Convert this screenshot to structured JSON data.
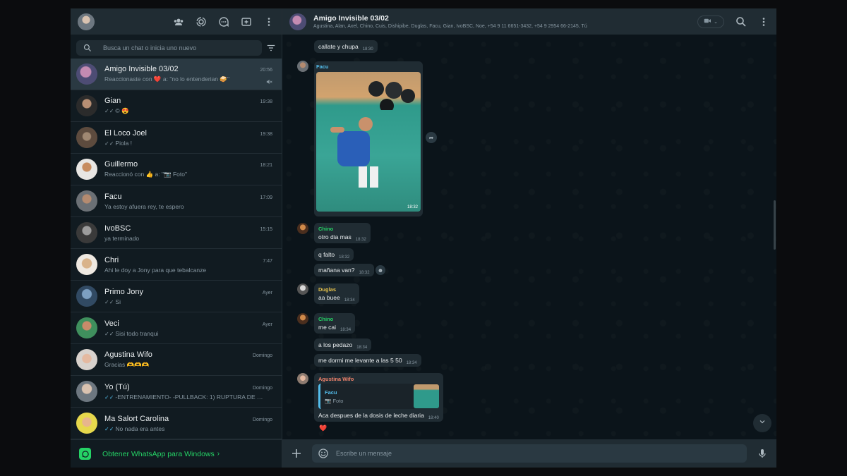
{
  "left": {
    "search_placeholder": "Busca un chat o inicia uno nuevo",
    "get_app_label": "Obtener WhatsApp para Windows",
    "chats": [
      {
        "name": "Amigo Invisible 03/02",
        "time": "20:56",
        "preview": "Reaccionaste con ❤️ a: \"no lo entenderian 🥪\"",
        "tick": "",
        "muted": true,
        "active": true
      },
      {
        "name": "Gian",
        "time": "19:38",
        "preview": "© 😍",
        "tick": "✓✓",
        "tick_blue": false
      },
      {
        "name": "El Loco Joel",
        "time": "19:38",
        "preview": "Piola !",
        "tick": "✓✓",
        "tick_blue": false
      },
      {
        "name": "Guillermo",
        "time": "18:21",
        "preview": "Reaccionó con 👍 a: \"📷 Foto\"",
        "tick": ""
      },
      {
        "name": "Facu",
        "time": "17:09",
        "preview": "Ya estoy afuera rey, te espero",
        "tick": ""
      },
      {
        "name": "IvoBSC",
        "time": "15:15",
        "preview": "ya terminado",
        "tick": ""
      },
      {
        "name": "Chri",
        "time": "7:47",
        "preview": "Ahi le doy a Jony para que tebalcanze",
        "tick": ""
      },
      {
        "name": "Primo Jony",
        "time": "Ayer",
        "preview": "Si",
        "tick": "✓✓",
        "tick_blue": false
      },
      {
        "name": "Veci",
        "time": "Ayer",
        "preview": "Sisi todo tranqui",
        "tick": "✓✓",
        "tick_blue": false
      },
      {
        "name": "Agustina Wifo",
        "time": "Domingo",
        "preview": "Gracias 🫶🫶🫶",
        "tick": ""
      },
      {
        "name": "Yo (Tú)",
        "time": "Domingo",
        "preview": "-ENTRENAMIENTO- -PULLBACK: 1) RUPTURA DE UNA Z...",
        "tick": "✓✓",
        "tick_blue": true
      },
      {
        "name": "Ma Salort Carolina",
        "time": "Domingo",
        "preview": "No nada era antes",
        "tick": "✓✓",
        "tick_blue": true
      }
    ]
  },
  "conversation": {
    "title": "Amigo Invisible 03/02",
    "members": "Agustina, Alan, Axel, Chino, Cuis, Dishipibe, Duglas, Facu, Gian, IvoBSC, Noe, +54 9 11 6651-3432, +54 9 2954 66-2145, Tú",
    "composer_placeholder": "Escribe un mensaje",
    "messages": [
      {
        "text": "callate y chupa",
        "time": "18:30"
      },
      {
        "sender": "Facu",
        "sender_color": "#53bdeb",
        "photo_time": "18:32"
      },
      {
        "sender": "Chino",
        "sender_color": "#25d366",
        "text": "otro dia mas",
        "time": "18:32"
      },
      {
        "text": "q falto",
        "time": "18:32"
      },
      {
        "text": "mañana van?",
        "time": "18:32"
      },
      {
        "sender": "Duglas",
        "sender_color": "#e5c14b",
        "text": "aa buee",
        "time": "18:34"
      },
      {
        "sender": "Chino",
        "sender_color": "#25d366",
        "text": "me cai",
        "time": "18:34"
      },
      {
        "text": "a los pedazo",
        "time": "18:34"
      },
      {
        "text": "me dormi me levante a las 5 50",
        "time": "18:34"
      },
      {
        "sender": "Agustina Wifo",
        "sender_color": "#f0826b",
        "quote_name": "Facu",
        "quote_text": "Foto",
        "text": "Aca despues de la dosis de leche diaria",
        "time": "18:40",
        "reaction": "❤️"
      }
    ]
  },
  "colors": {
    "accent": "#25d366",
    "panel": "#202c33",
    "background": "#0b141a",
    "bubble": "#202c33"
  }
}
